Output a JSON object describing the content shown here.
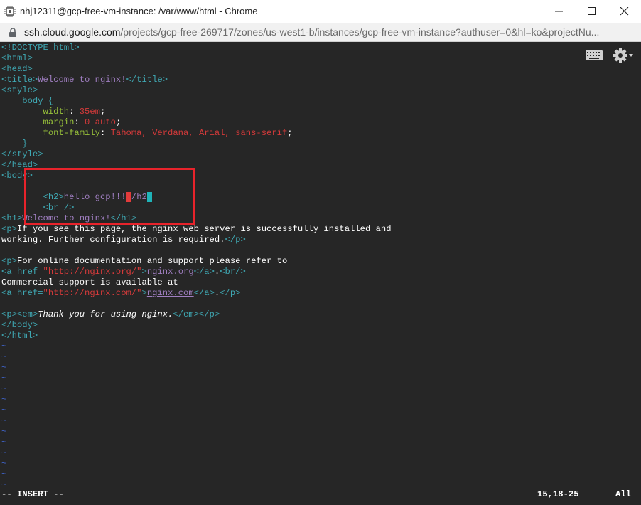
{
  "window": {
    "title": "nhj12311@gcp-free-vm-instance: /var/www/html - Chrome",
    "icons": {
      "app": "chip-icon",
      "minimize": "minimize-icon",
      "maximize": "maximize-icon",
      "close": "close-icon"
    }
  },
  "address": {
    "host": "ssh.cloud.google.com",
    "path": "/projects/gcp-free-269717/zones/us-west1-b/instances/gcp-free-vm-instance?authuser=0&hl=ko&projectNu...",
    "icon": "lock-icon"
  },
  "toolbar": {
    "icons": [
      "keyboard-icon",
      "gear-icon"
    ]
  },
  "editor": {
    "lines": [
      [
        {
          "t": "<!DOCTYPE html>",
          "c": "tag"
        }
      ],
      [
        {
          "t": "<html>",
          "c": "tag"
        }
      ],
      [
        {
          "t": "<head>",
          "c": "tag"
        }
      ],
      [
        {
          "t": "<title>",
          "c": "tag"
        },
        {
          "t": "Welcome to nginx!",
          "c": "purple"
        },
        {
          "t": "</title>",
          "c": "tag"
        }
      ],
      [
        {
          "t": "<style>",
          "c": "tag"
        }
      ],
      [
        {
          "t": "    body {",
          "c": "tag"
        }
      ],
      [
        {
          "t": "        ",
          "c": "white"
        },
        {
          "t": "width",
          "c": "green"
        },
        {
          "t": ": ",
          "c": "white"
        },
        {
          "t": "35em",
          "c": "red"
        },
        {
          "t": ";",
          "c": "white"
        }
      ],
      [
        {
          "t": "        ",
          "c": "white"
        },
        {
          "t": "margin",
          "c": "green"
        },
        {
          "t": ": ",
          "c": "white"
        },
        {
          "t": "0 auto",
          "c": "red"
        },
        {
          "t": ";",
          "c": "white"
        }
      ],
      [
        {
          "t": "        ",
          "c": "white"
        },
        {
          "t": "font-family",
          "c": "green"
        },
        {
          "t": ": ",
          "c": "white"
        },
        {
          "t": "Tahoma, Verdana, Arial, sans-serif",
          "c": "red"
        },
        {
          "t": ";",
          "c": "white"
        }
      ],
      [
        {
          "t": "    }",
          "c": "tag"
        }
      ],
      [
        {
          "t": "</style>",
          "c": "tag"
        }
      ],
      [
        {
          "t": "</head>",
          "c": "tag"
        }
      ],
      [
        {
          "t": "<body>",
          "c": "tag"
        }
      ],
      [
        {
          "t": "",
          "c": "white"
        }
      ],
      [
        {
          "t": "        ",
          "c": "white"
        },
        {
          "t": "<h2>",
          "c": "tag"
        },
        {
          "t": "hello gcp!!!",
          "c": "purple"
        },
        {
          "t": "<",
          "c": "cursor-red"
        },
        {
          "t": "/h2",
          "c": "purple"
        },
        {
          "t": ">",
          "c": "cursor-cyan"
        }
      ],
      [
        {
          "t": "        ",
          "c": "white"
        },
        {
          "t": "<br />",
          "c": "tag"
        }
      ],
      [
        {
          "t": "<h1>",
          "c": "tag"
        },
        {
          "t": "Welcome to nginx!",
          "c": "purple"
        },
        {
          "t": "</h1>",
          "c": "tag"
        }
      ],
      [
        {
          "t": "<p>",
          "c": "tag"
        },
        {
          "t": "If you see this page, the nginx web server is successfully installed and",
          "c": "white"
        }
      ],
      [
        {
          "t": "working. Further configuration is required.",
          "c": "white"
        },
        {
          "t": "</p>",
          "c": "tag"
        }
      ],
      [
        {
          "t": "",
          "c": "white"
        }
      ],
      [
        {
          "t": "<p>",
          "c": "tag"
        },
        {
          "t": "For online documentation and support please refer to",
          "c": "white"
        }
      ],
      [
        {
          "t": "<a href=",
          "c": "tag"
        },
        {
          "t": "\"http://nginx.org/\"",
          "c": "red"
        },
        {
          "t": ">",
          "c": "tag"
        },
        {
          "t": "nginx.org",
          "c": "link"
        },
        {
          "t": "</a>",
          "c": "tag"
        },
        {
          "t": ".",
          "c": "white"
        },
        {
          "t": "<br/>",
          "c": "tag"
        }
      ],
      [
        {
          "t": "Commercial support is available at",
          "c": "white"
        }
      ],
      [
        {
          "t": "<a href=",
          "c": "tag"
        },
        {
          "t": "\"http://nginx.com/\"",
          "c": "red"
        },
        {
          "t": ">",
          "c": "tag"
        },
        {
          "t": "nginx.com",
          "c": "link"
        },
        {
          "t": "</a>",
          "c": "tag"
        },
        {
          "t": ".",
          "c": "white"
        },
        {
          "t": "</p>",
          "c": "tag"
        }
      ],
      [
        {
          "t": "",
          "c": "white"
        }
      ],
      [
        {
          "t": "<p><em>",
          "c": "tag"
        },
        {
          "t": "Thank you for using nginx.",
          "c": "italic"
        },
        {
          "t": "</em></p>",
          "c": "tag"
        }
      ],
      [
        {
          "t": "</body>",
          "c": "tag"
        }
      ],
      [
        {
          "t": "</html>",
          "c": "tag"
        }
      ],
      [
        {
          "t": "~",
          "c": "tilde"
        }
      ],
      [
        {
          "t": "~",
          "c": "tilde"
        }
      ],
      [
        {
          "t": "~",
          "c": "tilde"
        }
      ],
      [
        {
          "t": "~",
          "c": "tilde"
        }
      ],
      [
        {
          "t": "~",
          "c": "tilde"
        }
      ],
      [
        {
          "t": "~",
          "c": "tilde"
        }
      ],
      [
        {
          "t": "~",
          "c": "tilde"
        }
      ],
      [
        {
          "t": "~",
          "c": "tilde"
        }
      ],
      [
        {
          "t": "~",
          "c": "tilde"
        }
      ],
      [
        {
          "t": "~",
          "c": "tilde"
        }
      ],
      [
        {
          "t": "~",
          "c": "tilde"
        }
      ],
      [
        {
          "t": "~",
          "c": "tilde"
        }
      ],
      [
        {
          "t": "~",
          "c": "tilde"
        }
      ],
      [
        {
          "t": "~",
          "c": "tilde"
        }
      ]
    ],
    "status_mode": "-- INSERT --",
    "status_position": "15,18-25",
    "status_scroll": "All"
  },
  "colors": {
    "background": "#262626",
    "tag": "#3fa8b3",
    "string": "#d43a3a",
    "property": "#97c03a",
    "text": "#9f7ec0",
    "highlight_box": "#e8232b"
  }
}
